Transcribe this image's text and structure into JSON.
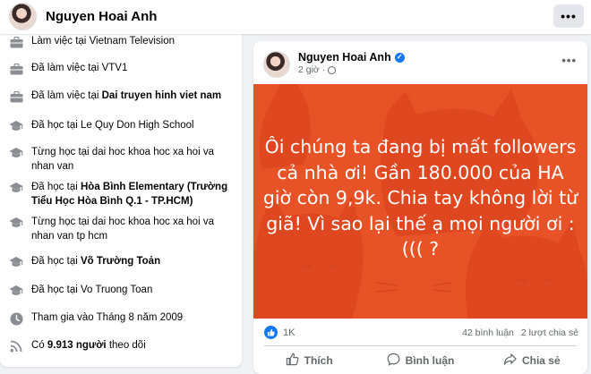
{
  "header": {
    "profile_name": "Nguyen Hoai Anh",
    "more_label": "•••"
  },
  "intro": {
    "items": [
      {
        "icon": "briefcase-icon",
        "prefix": "Làm việc tại ",
        "bold": "",
        "plain": "Vietnam Television"
      },
      {
        "icon": "briefcase-icon",
        "prefix": "Đã làm việc tại ",
        "bold": "",
        "plain": "VTV1"
      },
      {
        "icon": "briefcase-icon",
        "prefix": "Đã làm việc tại ",
        "bold": "Dai truyen hinh viet nam",
        "plain": ""
      },
      {
        "icon": "graduation-cap-icon",
        "prefix": "Đã học tại ",
        "bold": "",
        "plain": "Le Quy Don High School"
      },
      {
        "icon": "graduation-cap-icon",
        "prefix": "Từng học tại ",
        "bold": "",
        "plain": "dai hoc khoa hoc xa hoi va nhan van"
      },
      {
        "icon": "graduation-cap-icon",
        "prefix": "Đã học tại ",
        "bold": "Hòa Bình Elementary (Trường Tiểu Học Hòa Bình Q.1 - TP.HCM)",
        "plain": ""
      },
      {
        "icon": "graduation-cap-icon",
        "prefix": "Từng học tại ",
        "bold": "",
        "plain": "dai hoc khoa hoc xa hoi va nhan van tp hcm"
      },
      {
        "icon": "graduation-cap-icon",
        "prefix": "Đã học tại ",
        "bold": "Võ Trường Toản",
        "plain": ""
      },
      {
        "icon": "graduation-cap-icon",
        "prefix": "Đã học tại ",
        "bold": "",
        "plain": "Vo Truong Toan"
      },
      {
        "icon": "clock-icon",
        "prefix": "Tham gia vào Tháng 8 năm 2009",
        "bold": "",
        "plain": ""
      },
      {
        "icon": "rss-icon",
        "prefix": "Có ",
        "bold": "9.913 người",
        "plain": " theo dõi"
      }
    ]
  },
  "post": {
    "author": "Nguyen Hoai Anh",
    "time": "2 giờ",
    "dot": "·",
    "more_label": "•••",
    "text": "Ôi chúng ta đang bị mất followers cả nhà ơi! Gần 180.000 của HA giờ còn 9,9k. Chia tay không lời từ giã! Vì sao lại thế ạ mọi người ơi :((( ?",
    "background_color": "#e75326",
    "reaction_count": "1K",
    "comments": "42 bình luận",
    "shares": "2 lượt chia sẻ",
    "actions": {
      "like": "Thích",
      "comment": "Bình luận",
      "share": "Chia sẻ"
    }
  }
}
